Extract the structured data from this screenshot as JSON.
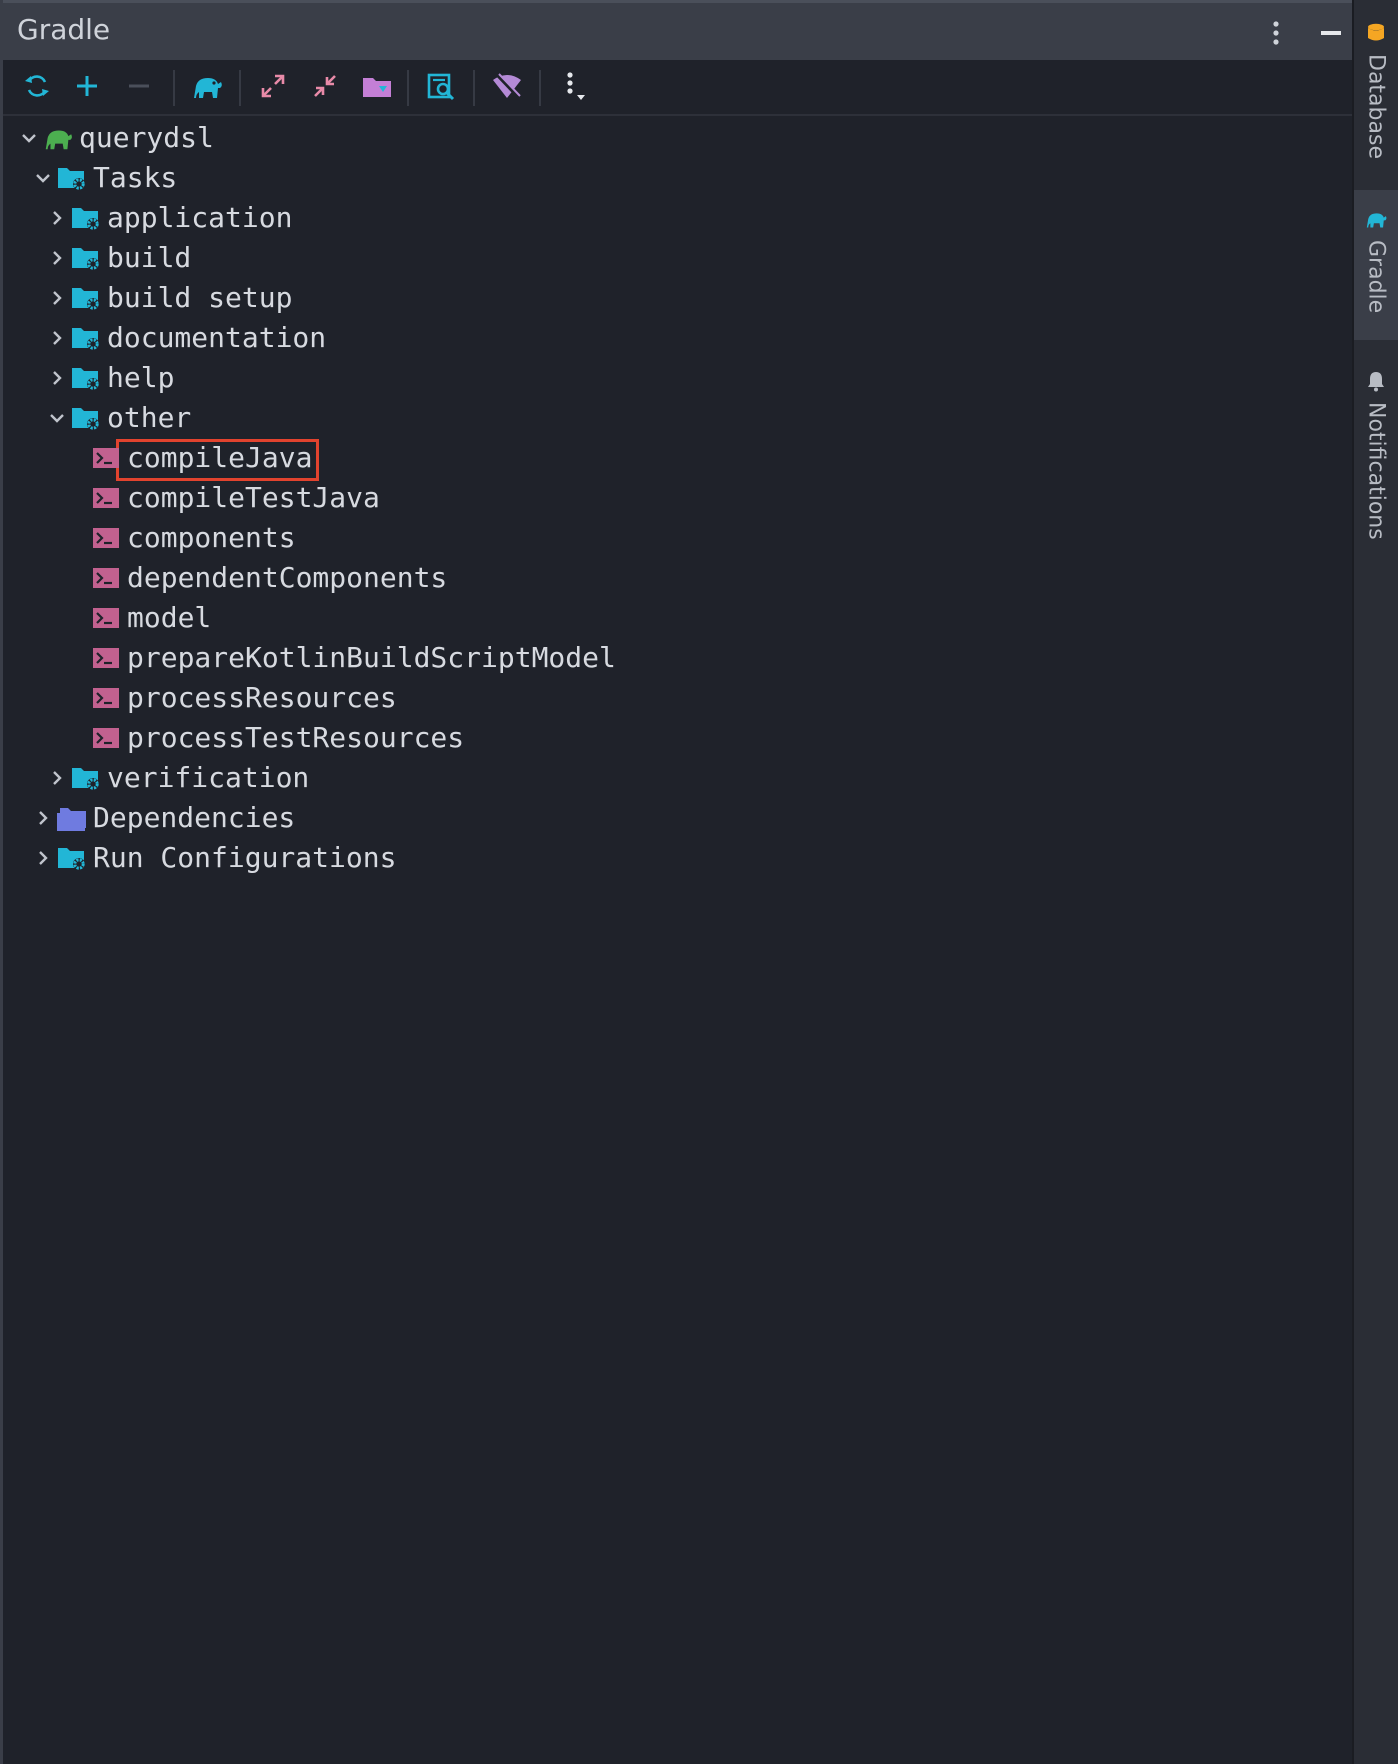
{
  "header": {
    "title": "Gradle"
  },
  "toolbar": {
    "items": [
      "refresh-icon",
      "add-icon",
      "remove-icon",
      "gradle-elephant-icon",
      "expand-all-icon",
      "collapse-all-icon",
      "open-folder-icon",
      "analyze-icon",
      "offline-mode-icon",
      "options-icon"
    ]
  },
  "tree": {
    "root": "querydsl",
    "tasks": "Tasks",
    "groups": {
      "application": "application",
      "build": "build",
      "build_setup": "build setup",
      "documentation": "documentation",
      "help": "help",
      "other": "other",
      "verification": "verification"
    },
    "other_tasks": [
      "compileJava",
      "compileTestJava",
      "components",
      "dependentComponents",
      "model",
      "prepareKotlinBuildScriptModel",
      "processResources",
      "processTestResources"
    ],
    "dependencies": "Dependencies",
    "run_configurations": "Run Configurations",
    "selected": "compileJava"
  },
  "rightbar": {
    "tabs": [
      "Database",
      "Gradle",
      "Notifications"
    ],
    "active": "Gradle"
  },
  "colors": {
    "accent_cyan": "#22b6d6",
    "task_pink": "#c2618f",
    "selection_red": "#e2432e",
    "gradle_green": "#4caf50"
  }
}
